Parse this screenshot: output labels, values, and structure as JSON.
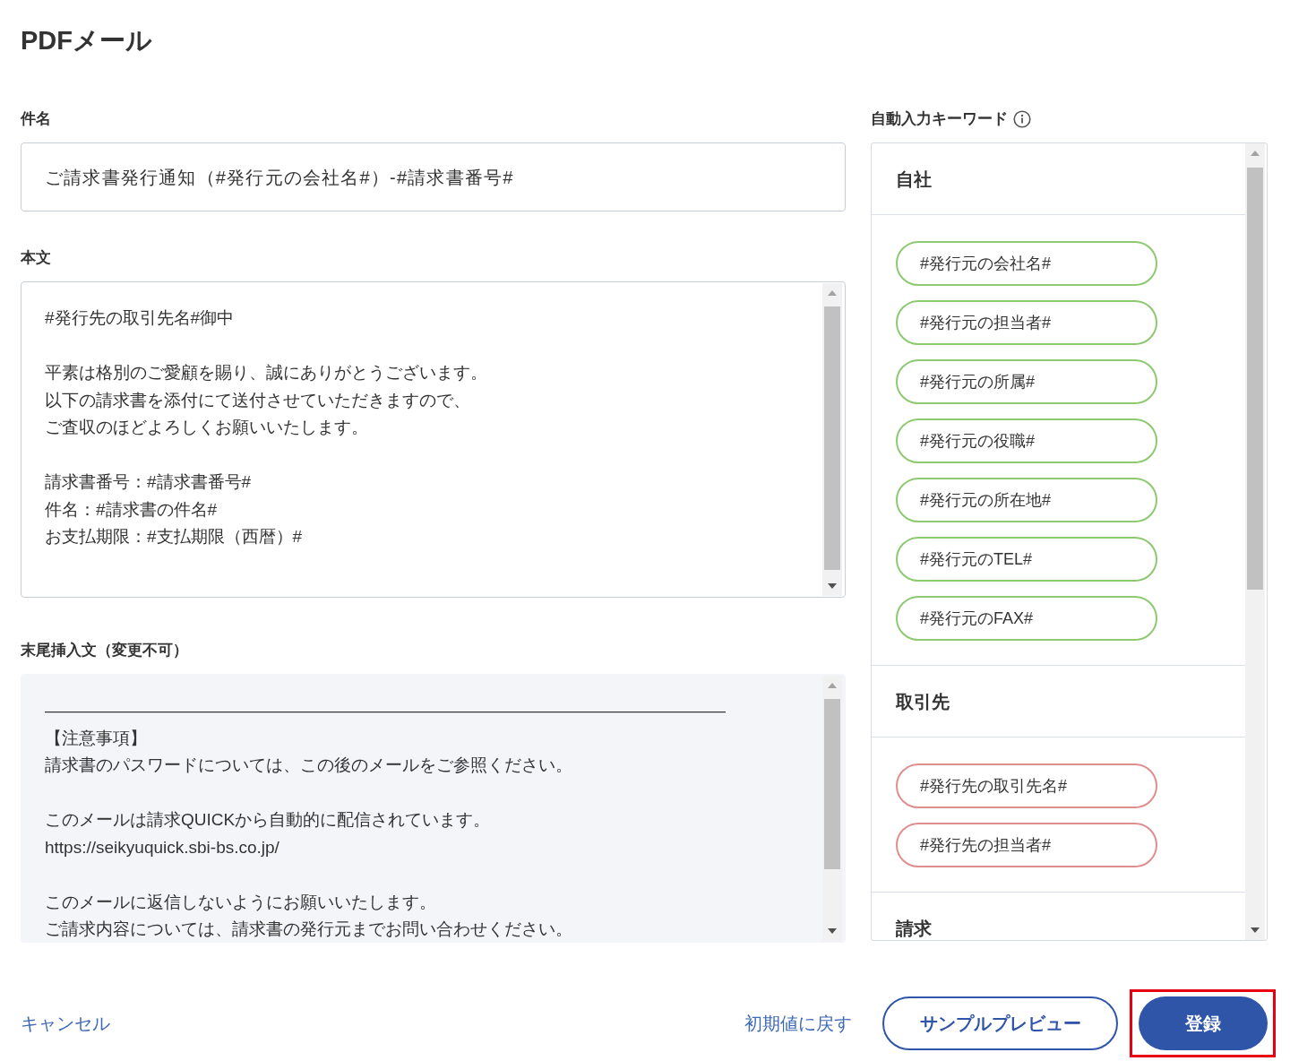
{
  "page": {
    "title": "PDFメール"
  },
  "subject": {
    "label": "件名",
    "value": "ご請求書発行通知（#発行元の会社名#）-#請求書番号#"
  },
  "body": {
    "label": "本文",
    "paragraphs": [
      [
        "#発行先の取引先名#御中"
      ],
      [
        "平素は格別のご愛顧を賜り、誠にありがとうございます。",
        "以下の請求書を添付にて送付させていただきますので、",
        "ご査収のほどよろしくお願いいたします。"
      ],
      [
        "請求書番号：#請求書番号#",
        "件名：#請求書の件名#",
        "お支払期限：#支払期限（西暦）#"
      ]
    ],
    "disabled": false
  },
  "footer_text": {
    "label": "末尾挿入文（変更不可）",
    "paragraphs": [
      [
        "――――――――――――――――――――――――――――――――――――――――",
        "【注意事項】",
        "請求書のパスワードについては、この後のメールをご参照ください。"
      ],
      [
        "このメールは請求QUICKから自動的に配信されています。",
        "https://seikyuquick.sbi-bs.co.jp/"
      ],
      [
        "このメールに返信しないようにお願いいたします。",
        "ご請求内容については、請求書の発行元までお問い合わせください。"
      ]
    ],
    "disabled": true
  },
  "keywords": {
    "label": "自動入力キーワード",
    "groups": [
      {
        "title": "自社",
        "color": "#8dc970",
        "keywords": [
          "#発行元の会社名#",
          "#発行元の担当者#",
          "#発行元の所属#",
          "#発行元の役職#",
          "#発行元の所在地#",
          "#発行元のTEL#",
          "#発行元のFAX#"
        ]
      },
      {
        "title": "取引先",
        "color": "#de8e8e",
        "keywords": [
          "#発行先の取引先名#",
          "#発行先の担当者#"
        ]
      },
      {
        "title": "請求"
      }
    ]
  },
  "actions": {
    "cancel": "キャンセル",
    "reset": "初期値に戻す",
    "buttons": [
      {
        "label": "サンプルプレビュー",
        "kind": "outline",
        "highlighted": false
      },
      {
        "label": "登録",
        "kind": "primary",
        "highlighted": true
      }
    ]
  }
}
